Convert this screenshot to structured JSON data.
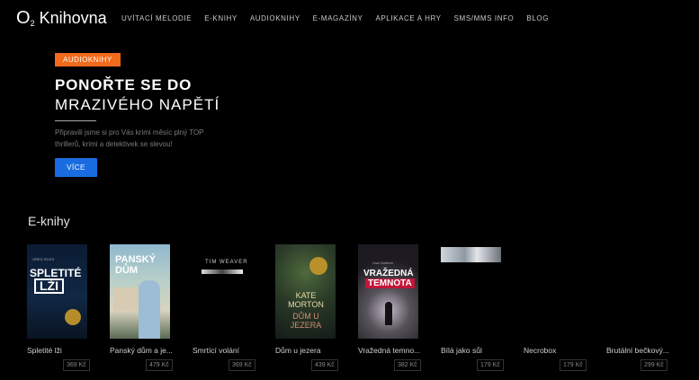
{
  "header": {
    "logo_o2": "O",
    "logo_sub": "2",
    "logo_name": "Knihovna",
    "nav": [
      "UVÍTACÍ MELODIE",
      "E-KNIHY",
      "AUDIOKNIHY",
      "E-MAGAZÍNY",
      "APLIKACE A HRY",
      "SMS/MMS INFO",
      "BLOG"
    ]
  },
  "hero": {
    "badge": "AUDIOKNIHY",
    "title_line1": "PONOŘTE SE DO",
    "title_line2": "MRAZIVÉHO NAPĚTÍ",
    "text": "Připravili jsme si pro Vás krimi měsíc plný TOP thrillerů, krimi a detektivek se slevou!",
    "button": "VÍCE",
    "badge_color": "#f26a1b",
    "button_color": "#1a6de0"
  },
  "section": {
    "title": "E-knihy",
    "books": [
      {
        "title": "Spletité lži",
        "price": "369 Kč"
      },
      {
        "title": "Panský dům a je...",
        "price": "479 Kč"
      },
      {
        "title": "Smrtící volání",
        "price": "369 Kč"
      },
      {
        "title": "Dům u jezera",
        "price": "439 Kč"
      },
      {
        "title": "Vražedná temno...",
        "price": "382 Kč"
      },
      {
        "title": "Bílá jako sůl",
        "price": "179 Kč"
      },
      {
        "title": "Necrobox",
        "price": "179 Kč"
      },
      {
        "title": "Brutální bečkový...",
        "price": "299 Kč"
      }
    ],
    "covers": {
      "c1": {
        "author": "GREG ISLES",
        "title1": "SPLETITÉ",
        "title2": "LŽI"
      },
      "c2": {
        "title": "PANSKÝ DŮM"
      },
      "c3": {
        "author": "TIM WEAVER"
      },
      "c4": {
        "author": "KATE MORTON",
        "title": "DŮM U JEZERA"
      },
      "c5": {
        "author": "Lisa Gardner",
        "title1": "VRAŽEDNÁ",
        "title2": "TEMNOTA"
      }
    }
  }
}
